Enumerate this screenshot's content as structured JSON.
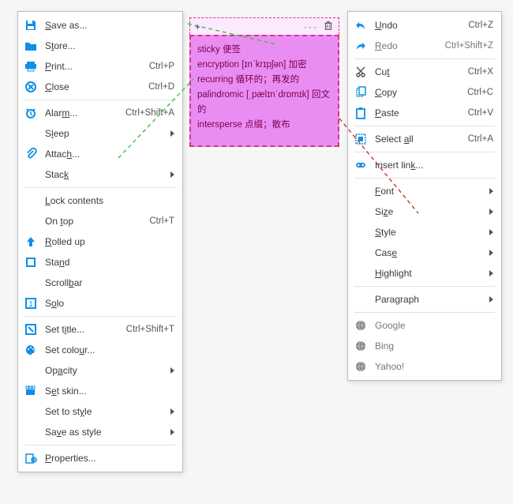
{
  "left_menu": {
    "items": [
      {
        "name": "save-as",
        "icon": "save-icon",
        "pre": "",
        "ul": "S",
        "post": "ave as...",
        "accel": "",
        "sub": false
      },
      {
        "name": "store",
        "icon": "folder-icon",
        "pre": "S",
        "ul": "t",
        "post": "ore...",
        "accel": "",
        "sub": false
      },
      {
        "name": "print",
        "icon": "print-icon",
        "pre": "",
        "ul": "P",
        "post": "rint...",
        "accel": "Ctrl+P",
        "sub": false
      },
      {
        "name": "close",
        "icon": "close-icon",
        "pre": "",
        "ul": "C",
        "post": "lose",
        "accel": "Ctrl+D",
        "sub": false
      },
      {
        "sep": true
      },
      {
        "name": "alarm",
        "icon": "alarm-icon",
        "pre": "Alar",
        "ul": "m",
        "post": "...",
        "accel": "Ctrl+Shift+A",
        "sub": false
      },
      {
        "name": "sleep",
        "icon": "",
        "pre": "S",
        "ul": "l",
        "post": "eep",
        "accel": "",
        "sub": true
      },
      {
        "name": "attach",
        "icon": "attach-icon",
        "pre": "Attac",
        "ul": "h",
        "post": "...",
        "accel": "",
        "sub": false
      },
      {
        "name": "stack",
        "icon": "",
        "pre": "Stac",
        "ul": "k",
        "post": "",
        "accel": "",
        "sub": true
      },
      {
        "sep": true
      },
      {
        "name": "lock-contents",
        "icon": "",
        "pre": "",
        "ul": "L",
        "post": "ock contents",
        "accel": "",
        "sub": false
      },
      {
        "name": "on-top",
        "icon": "",
        "pre": "On ",
        "ul": "t",
        "post": "op",
        "accel": "Ctrl+T",
        "sub": false
      },
      {
        "name": "rolled-up",
        "icon": "rolledup-icon",
        "pre": "",
        "ul": "R",
        "post": "olled up",
        "accel": "",
        "sub": false
      },
      {
        "name": "stand",
        "icon": "stand-icon",
        "pre": "Sta",
        "ul": "n",
        "post": "d",
        "accel": "",
        "sub": false
      },
      {
        "name": "scrollbar",
        "icon": "",
        "pre": "Scroll",
        "ul": "b",
        "post": "ar",
        "accel": "",
        "sub": false
      },
      {
        "name": "solo",
        "icon": "solo-icon",
        "pre": "S",
        "ul": "o",
        "post": "lo",
        "accel": "",
        "sub": false
      },
      {
        "sep": true
      },
      {
        "name": "set-title",
        "icon": "title-icon",
        "pre": "Set t",
        "ul": "i",
        "post": "tle...",
        "accel": "Ctrl+Shift+T",
        "sub": false
      },
      {
        "name": "set-colour",
        "icon": "palette-icon",
        "pre": "Set colo",
        "ul": "u",
        "post": "r...",
        "accel": "",
        "sub": false
      },
      {
        "name": "opacity",
        "icon": "",
        "pre": "Op",
        "ul": "a",
        "post": "city",
        "accel": "",
        "sub": true
      },
      {
        "name": "set-skin",
        "icon": "skin-icon",
        "pre": "S",
        "ul": "e",
        "post": "t skin...",
        "accel": "",
        "sub": false
      },
      {
        "name": "set-to-style",
        "icon": "",
        "pre": "Set to st",
        "ul": "y",
        "post": "le",
        "accel": "",
        "sub": true
      },
      {
        "name": "save-as-style",
        "icon": "",
        "pre": "Sa",
        "ul": "v",
        "post": "e as style",
        "accel": "",
        "sub": true
      },
      {
        "sep": true
      },
      {
        "name": "properties",
        "icon": "properties-icon",
        "pre": "",
        "ul": "P",
        "post": "roperties...",
        "accel": "",
        "sub": false
      }
    ]
  },
  "right_menu": {
    "items": [
      {
        "name": "undo",
        "icon": "undo-icon",
        "pre": "",
        "ul": "U",
        "post": "ndo",
        "accel": "Ctrl+Z",
        "sub": false
      },
      {
        "name": "redo",
        "icon": "redo-icon",
        "pre": "",
        "ul": "R",
        "post": "edo",
        "accel": "Ctrl+Shift+Z",
        "sub": false,
        "disabled": true
      },
      {
        "sep": true
      },
      {
        "name": "cut",
        "icon": "cut-icon",
        "pre": "Cu",
        "ul": "t",
        "post": "",
        "accel": "Ctrl+X",
        "sub": false
      },
      {
        "name": "copy",
        "icon": "copy-icon",
        "pre": "",
        "ul": "C",
        "post": "opy",
        "accel": "Ctrl+C",
        "sub": false
      },
      {
        "name": "paste",
        "icon": "paste-icon",
        "pre": "",
        "ul": "P",
        "post": "aste",
        "accel": "Ctrl+V",
        "sub": false
      },
      {
        "sep": true
      },
      {
        "name": "select-all",
        "icon": "selectall-icon",
        "pre": "Select ",
        "ul": "a",
        "post": "ll",
        "accel": "Ctrl+A",
        "sub": false
      },
      {
        "sep": true
      },
      {
        "name": "insert-link",
        "icon": "link-icon",
        "pre": "Insert lin",
        "ul": "k",
        "post": "...",
        "accel": "",
        "sub": false
      },
      {
        "sep": true
      },
      {
        "name": "font",
        "icon": "",
        "pre": "",
        "ul": "F",
        "post": "ont",
        "accel": "",
        "sub": true
      },
      {
        "name": "size",
        "icon": "",
        "pre": "Si",
        "ul": "z",
        "post": "e",
        "accel": "",
        "sub": true
      },
      {
        "name": "style",
        "icon": "",
        "pre": "",
        "ul": "S",
        "post": "tyle",
        "accel": "",
        "sub": true
      },
      {
        "name": "case",
        "icon": "",
        "pre": "Cas",
        "ul": "e",
        "post": "",
        "accel": "",
        "sub": true
      },
      {
        "name": "highlight",
        "icon": "",
        "pre": "",
        "ul": "H",
        "post": "ighlight",
        "accel": "",
        "sub": true
      },
      {
        "sep": true
      },
      {
        "name": "paragraph",
        "icon": "",
        "pre": "Para",
        "ul": "g",
        "post": "raph",
        "accel": "",
        "sub": true
      },
      {
        "sep": true
      },
      {
        "name": "google",
        "icon": "globe-icon",
        "pre": "",
        "ul": "",
        "post": "Google",
        "accel": "",
        "sub": false,
        "disabled": true
      },
      {
        "name": "bing",
        "icon": "globe-icon",
        "pre": "",
        "ul": "",
        "post": "Bing",
        "accel": "",
        "sub": false,
        "disabled": true
      },
      {
        "name": "yahoo",
        "icon": "globe-icon",
        "pre": "",
        "ul": "",
        "post": "Yahoo!",
        "accel": "",
        "sub": false,
        "disabled": true
      }
    ]
  },
  "note": {
    "toolbar": {
      "add": "+",
      "more": "···",
      "delete": "🗑"
    },
    "lines": [
      "sticky 便签",
      "encryption [ɪnˈkrɪpʃən] 加密",
      "recurring 循环的；再发的",
      "palindromic [ˌpælɪnˈdrɒmɪk] 回文的",
      "intersperse 点缀；散布"
    ]
  }
}
